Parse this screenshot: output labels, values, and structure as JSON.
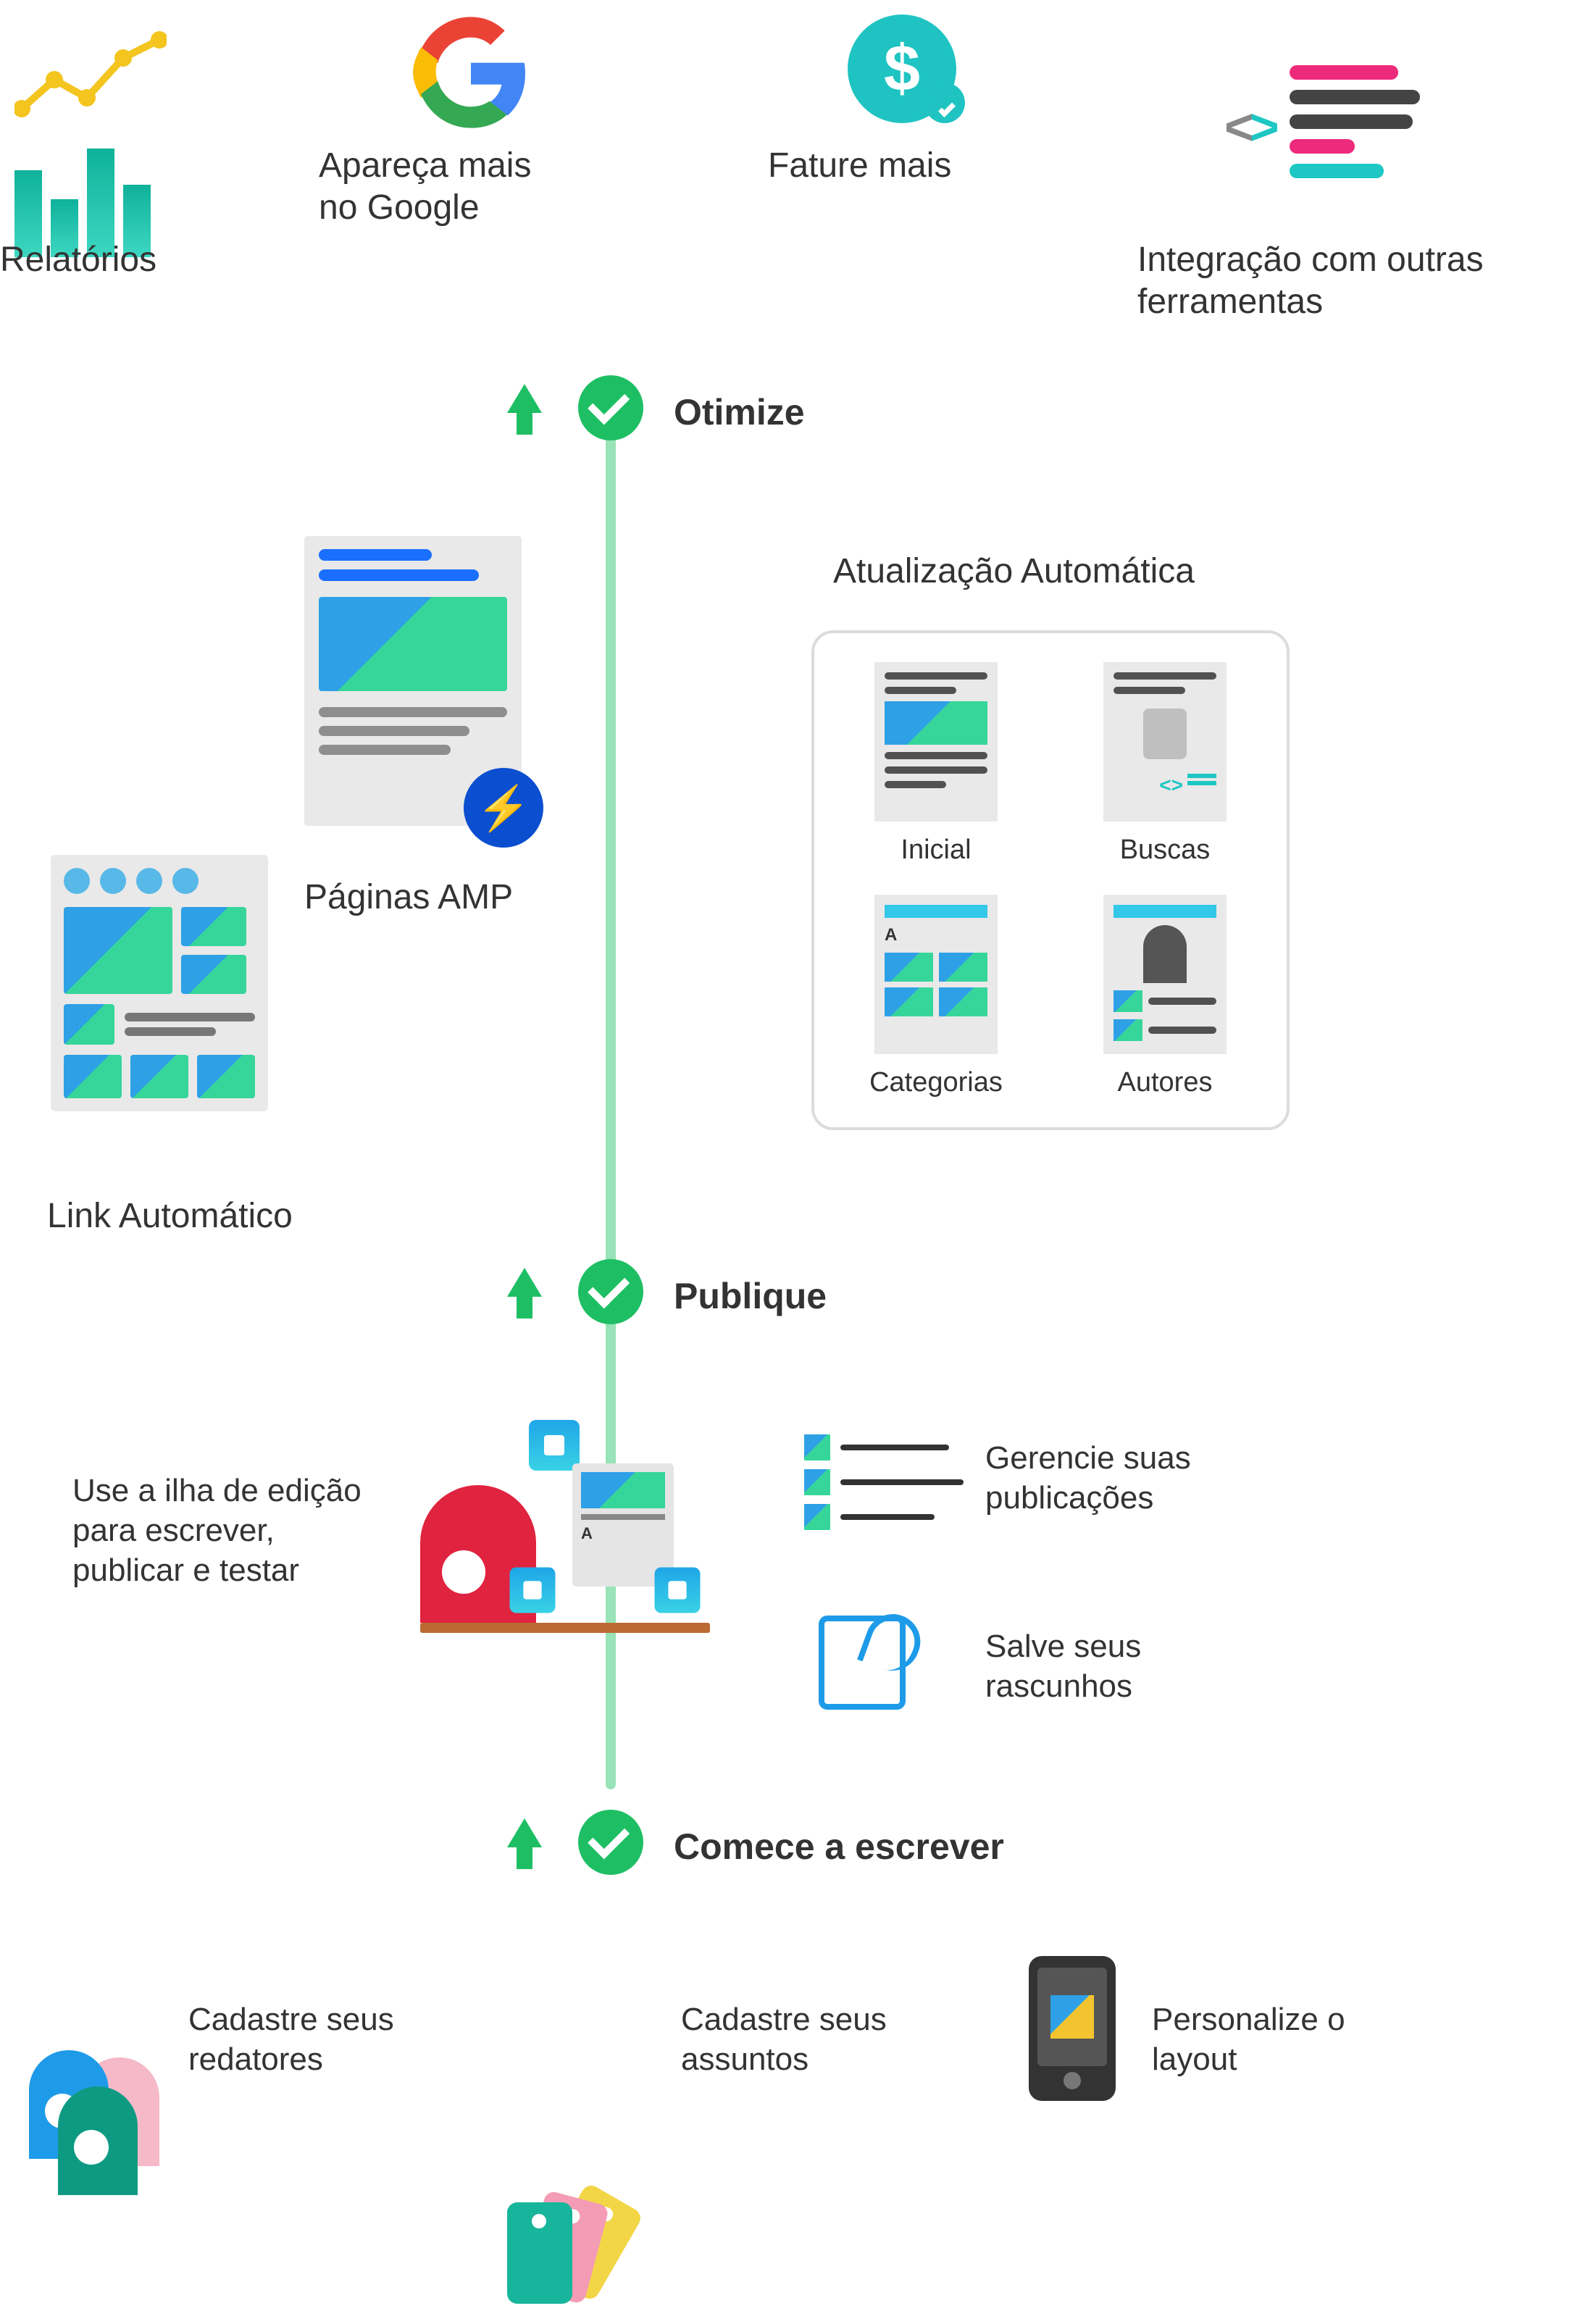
{
  "top_features": {
    "reports": "Relatórios",
    "google": "Apareça mais no Google",
    "revenue": "Fature mais",
    "integration": "Integração com outras ferramentas"
  },
  "stages": {
    "optimize": "Otimize",
    "publish": "Publique",
    "start": "Comece a escrever"
  },
  "optimize_section": {
    "amp": "Páginas AMP",
    "link": "Link Automático",
    "auto_update": "Atualização Automática",
    "update_items": {
      "inicial": "Inicial",
      "buscas": "Buscas",
      "categorias": "Categorias",
      "autores": "Autores"
    }
  },
  "publish_section": {
    "ilha": "Use a ilha de edição para escrever, publicar e testar",
    "manage": "Gerencie suas publicações",
    "drafts": "Salve seus rascunhos"
  },
  "start_section": {
    "writers": "Cadastre seus redatores",
    "subjects": "Cadastre seus assuntos",
    "layout": "Personalize o layout"
  }
}
